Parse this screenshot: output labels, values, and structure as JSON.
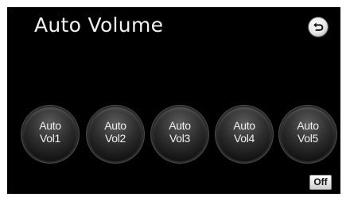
{
  "screen": {
    "title": "Auto Volume"
  },
  "header": {
    "back_icon": "return-arrow-icon"
  },
  "volume_buttons": [
    {
      "line1": "Auto",
      "line2": "Vol1"
    },
    {
      "line1": "Auto",
      "line2": "Vol2"
    },
    {
      "line1": "Auto",
      "line2": "Vol3"
    },
    {
      "line1": "Auto",
      "line2": "Vol4"
    },
    {
      "line1": "Auto",
      "line2": "Vol5"
    }
  ],
  "off_button": {
    "label": "Off"
  },
  "colors": {
    "background": "#000000",
    "text": "#f2f2f2"
  }
}
